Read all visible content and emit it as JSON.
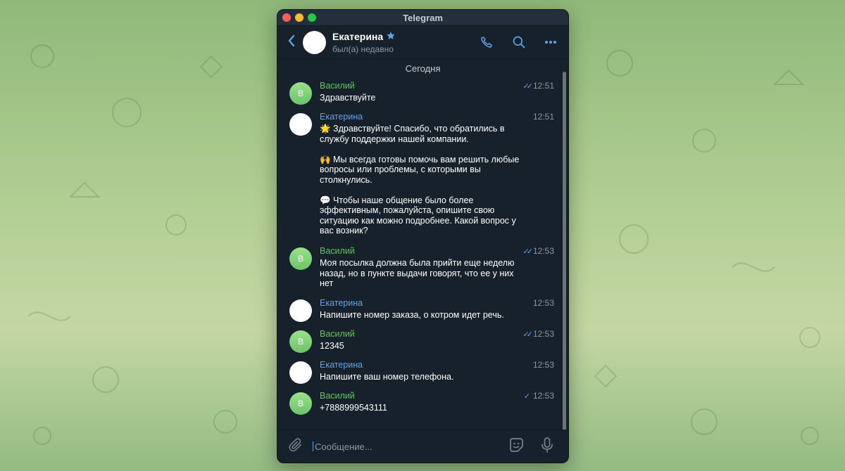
{
  "window": {
    "title": "Telegram"
  },
  "header": {
    "name": "Екатерина",
    "status": "был(а) недавно",
    "icons": [
      "back-icon",
      "phone-icon",
      "search-icon",
      "more-icon",
      "star-icon"
    ]
  },
  "chat": {
    "date_separator": "Сегодня",
    "messages": [
      {
        "sender": "Василий",
        "avatar_letter": "В",
        "text": "Здравствуйте",
        "time": "12:51",
        "status": "read"
      },
      {
        "sender": "Екатерина",
        "text": "🌟 Здравствуйте! Спасибо, что обратились в службу поддержки нашей компании.\n\n🙌 Мы всегда готовы помочь вам решить любые вопросы или проблемы, с которыми вы столкнулись.\n\n💬 Чтобы наше общение было более эффективным, пожалуйста, опишите свою ситуацию как можно подробнее. Какой вопрос у вас возник?",
        "time": "12:51"
      },
      {
        "sender": "Василий",
        "avatar_letter": "В",
        "text": "Моя посылка должна была прийти еще неделю назад, но в пункте выдачи говорят, что ее у них нет",
        "time": "12:53",
        "status": "read"
      },
      {
        "sender": "Екатерина",
        "text": "Напишите номер заказа, о котром идет речь.",
        "time": "12:53"
      },
      {
        "sender": "Василий",
        "avatar_letter": "В",
        "text": "12345",
        "time": "12:53",
        "status": "read"
      },
      {
        "sender": "Екатерина",
        "text": "Напишите ваш номер телефона.",
        "time": "12:53"
      },
      {
        "sender": "Василий",
        "avatar_letter": "В",
        "text": "+7888999543111",
        "time": "12:53",
        "status": "sent"
      }
    ]
  },
  "input": {
    "placeholder": "Сообщение...",
    "icons": [
      "attach-icon",
      "sticker-icon",
      "microphone-icon"
    ]
  },
  "colors": {
    "panel": "#17212b",
    "accent": "#5fa4e6",
    "sender_green": "#5ec55c"
  }
}
